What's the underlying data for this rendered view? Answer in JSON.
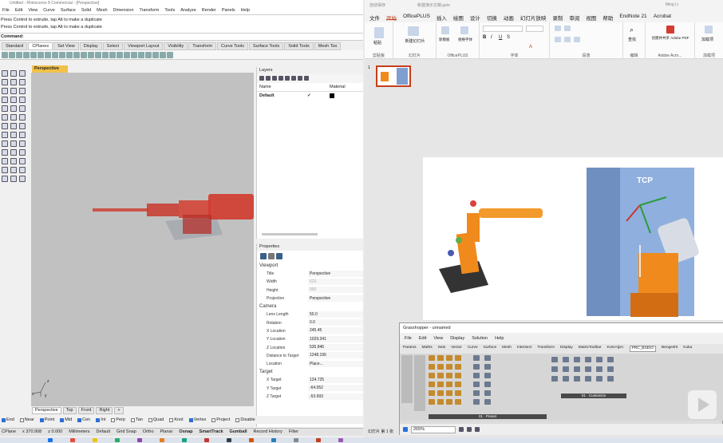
{
  "rhino": {
    "title": "Untitled - Rhinoceros 8 Commercial - [Perspective]",
    "menu": [
      "File",
      "Edit",
      "View",
      "Curve",
      "Surface",
      "Solid",
      "Mesh",
      "Dimension",
      "Transform",
      "Tools",
      "Analyze",
      "Render",
      "Panels",
      "Help"
    ],
    "command_history": [
      "Press Control to extrude, tap Alt to make a duplicate",
      "Press Control to extrude, tap Alt to make a duplicate"
    ],
    "command_label": "Command:",
    "tabs": [
      "Standard",
      "CPlanes",
      "Set View",
      "Display",
      "Select",
      "Viewport Layout",
      "Visibility",
      "Transform",
      "Curve Tools",
      "Surface Tools",
      "Solid Tools",
      "Mesh Too"
    ],
    "viewport_title": "Perspective",
    "axis_labels": {
      "z": "z",
      "y": "y",
      "x": "x"
    },
    "viewport_tabs": [
      "Perspective",
      "Top",
      "Front",
      "Right"
    ],
    "osnaps": [
      {
        "label": "End",
        "checked": true
      },
      {
        "label": "Near",
        "checked": false
      },
      {
        "label": "Point",
        "checked": true
      },
      {
        "label": "Mid",
        "checked": true
      },
      {
        "label": "Cen",
        "checked": true
      },
      {
        "label": "Int",
        "checked": true
      },
      {
        "label": "Perp",
        "checked": false
      },
      {
        "label": "Tan",
        "checked": false
      },
      {
        "label": "Quad",
        "checked": false
      },
      {
        "label": "Knot",
        "checked": false
      },
      {
        "label": "Vertex",
        "checked": true
      },
      {
        "label": "Project",
        "checked": false
      },
      {
        "label": "Disable",
        "checked": false
      }
    ],
    "status": {
      "cplane": "CPlane",
      "x": "x 370.908",
      "z": "z 0.000",
      "units": "Millimeters",
      "layer": "Default",
      "grid_snap": "Grid Snap",
      "ortho": "Ortho",
      "planar": "Planar",
      "osnap": "Osnap",
      "smarttrack": "SmartTrack",
      "gumball": "Gumball",
      "record_history": "Record History",
      "filter": "Filter"
    },
    "layers": {
      "title": "Layers",
      "columns": [
        "Name",
        "",
        "",
        "Material"
      ],
      "rows": [
        {
          "name": "Default",
          "check": "✓"
        }
      ]
    },
    "properties": {
      "title": "Properties",
      "viewport_section": "Viewport",
      "viewport_rows": [
        {
          "key": "Title",
          "value": "Perspective",
          "disabled": false
        },
        {
          "key": "Width",
          "value": "623",
          "disabled": true
        },
        {
          "key": "Height",
          "value": "950",
          "disabled": true
        },
        {
          "key": "Projection",
          "value": "Perspective",
          "disabled": false
        }
      ],
      "camera_section": "Camera",
      "camera_rows": [
        {
          "key": "Lens Length",
          "value": "50.0"
        },
        {
          "key": "Rotation",
          "value": "0.0"
        },
        {
          "key": "X Location",
          "value": "245.45"
        },
        {
          "key": "Y Location",
          "value": "1029.341"
        },
        {
          "key": "Z Location",
          "value": "535.846"
        },
        {
          "key": "Distance to Target",
          "value": "1248.195"
        },
        {
          "key": "Location",
          "value": "Place..."
        }
      ],
      "target_section": "Target",
      "target_rows": [
        {
          "key": "X Target",
          "value": "124.725"
        },
        {
          "key": "Y Target",
          "value": "-64.052"
        },
        {
          "key": "Z Target",
          "value": "-53.993"
        }
      ]
    }
  },
  "ppt": {
    "title_left": "自动保存",
    "title_file": "新建演示文稿.pptx",
    "title_user": "Ming Li",
    "tabs": [
      "文件",
      "开始",
      "OfficePLUS",
      "插入",
      "绘图",
      "设计",
      "切换",
      "动画",
      "幻灯片放映",
      "录制",
      "审阅",
      "视图",
      "帮助",
      "EndNote 21",
      "Acrobat"
    ],
    "active_tab": "开始",
    "groups": [
      "剪贴板",
      "幻灯片",
      "OfficePLUS",
      "字体",
      "段落",
      "编辑",
      "Adobe Acro...",
      "加载项"
    ],
    "buttons": {
      "paste": "粘贴",
      "new_slide": "新建幻灯片",
      "new_template": "新模板",
      "replace_font": "替换字体",
      "find": "查找",
      "create_pdf": "创建并共享 Adobe PDF",
      "addins": "加载项"
    },
    "slide_number": "1",
    "tcp_label": "TCP",
    "status": "幻灯片 第 1 张"
  },
  "grasshopper": {
    "title": "Grasshopper - unnamed",
    "menu": [
      "File",
      "Edit",
      "View",
      "Display",
      "Solution",
      "Help"
    ],
    "tabs": [
      "Params",
      "Maths",
      "Sets",
      "Vector",
      "Curve",
      "Surface",
      "Mesh",
      "Intersect",
      "Transform",
      "Display",
      "MatrixToolbar",
      "KUKA|prc",
      "PRC_BSEIO",
      "Bengesht",
      "Kuka"
    ],
    "active_tab": "PRC_BSEIO",
    "categories": {
      "c1": "01 · Preset",
      "c2": "01 · Customize"
    },
    "zoom": "265%"
  },
  "colors": {
    "ppt_accent": "#c43e1c",
    "rhino_viewport_tab": "#f2c14a",
    "robot_orange": "#f08a1d",
    "osnap_check": "#2a6fd6"
  }
}
